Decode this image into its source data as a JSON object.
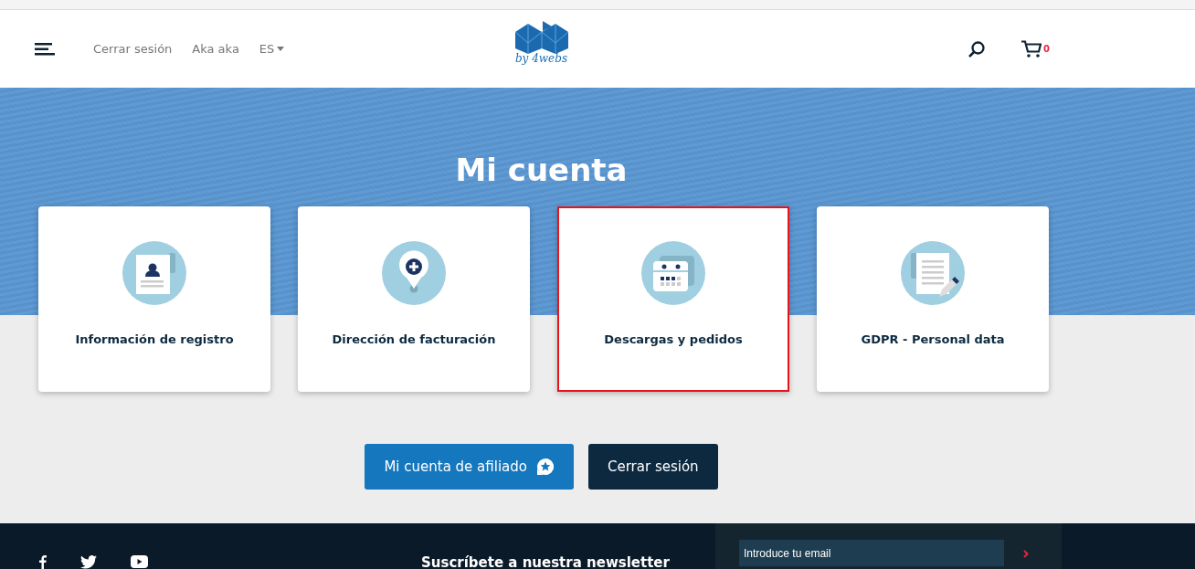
{
  "header": {
    "links": [
      {
        "label": "Cerrar sesión"
      },
      {
        "label": "Aka aka"
      }
    ],
    "language": "ES",
    "logo_text": "by 4webs",
    "cart_count": "0"
  },
  "page_title": "Mi cuenta",
  "cards": [
    {
      "label": "Información de registro",
      "kind": "profile",
      "selected": false
    },
    {
      "label": "Dirección de facturación",
      "kind": "pin",
      "selected": false
    },
    {
      "label": "Descargas y pedidos",
      "kind": "calendar",
      "selected": true
    },
    {
      "label": "GDPR - Personal data",
      "kind": "document",
      "selected": false
    }
  ],
  "buttons": [
    {
      "label": "Mi cuenta de afiliado",
      "kind": "primary"
    },
    {
      "label": "Cerrar sesión",
      "kind": "dark"
    }
  ],
  "footer": {
    "newsletter_title": "Suscríbete a nuestra newsletter",
    "email_placeholder": "Introduce tu email"
  }
}
